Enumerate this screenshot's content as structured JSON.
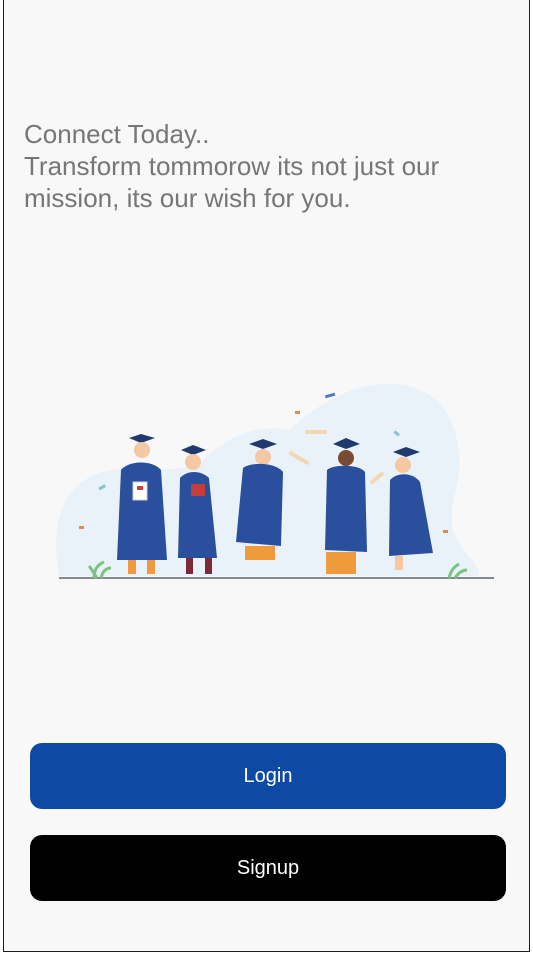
{
  "onboarding": {
    "tagline_line1": "Connect Today..",
    "tagline_line2": "Transform tommorow its not just our mission, its our wish for you."
  },
  "actions": {
    "login_label": "Login",
    "signup_label": "Signup"
  },
  "colors": {
    "login_bg": "#0e4aa4",
    "signup_bg": "#000000",
    "tagline_text": "#767676"
  },
  "illustration": {
    "icon": "graduates-celebrating-icon"
  }
}
